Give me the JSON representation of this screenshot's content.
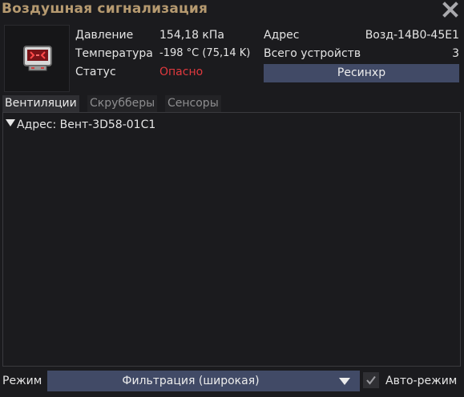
{
  "window": {
    "title": "Воздушная сигнализация",
    "close_icon": "close-icon"
  },
  "device": {
    "icon": "air-alarm-icon",
    "pressure_label": "Давление",
    "pressure_value": "154,18 кПа",
    "temperature_label": "Температура",
    "temperature_value": "-198 °C (75,14 K)",
    "status_label": "Статус",
    "status_value": "Опасно",
    "address_label": "Адрес",
    "address_value": "Возд-14B0-45E1",
    "total_devices_label": "Всего устройств",
    "total_devices_value": "3",
    "resync_label": "Ресинхр"
  },
  "colors": {
    "title": "#b69a70",
    "danger": "#e0393e",
    "button": "#414a66",
    "background": "#1b1b1e"
  },
  "tabs": [
    {
      "label": "Вентиляции",
      "active": true
    },
    {
      "label": "Скрубберы",
      "active": false
    },
    {
      "label": "Сенсоры",
      "active": false
    }
  ],
  "vents": [
    {
      "label": "Адрес: Вент-3D58-01C1",
      "expanded": false
    }
  ],
  "footer": {
    "mode_label": "Режим",
    "mode_value": "Фильтрация (широкая)",
    "auto_mode_label": "Авто-режим",
    "auto_mode_checked": true
  }
}
